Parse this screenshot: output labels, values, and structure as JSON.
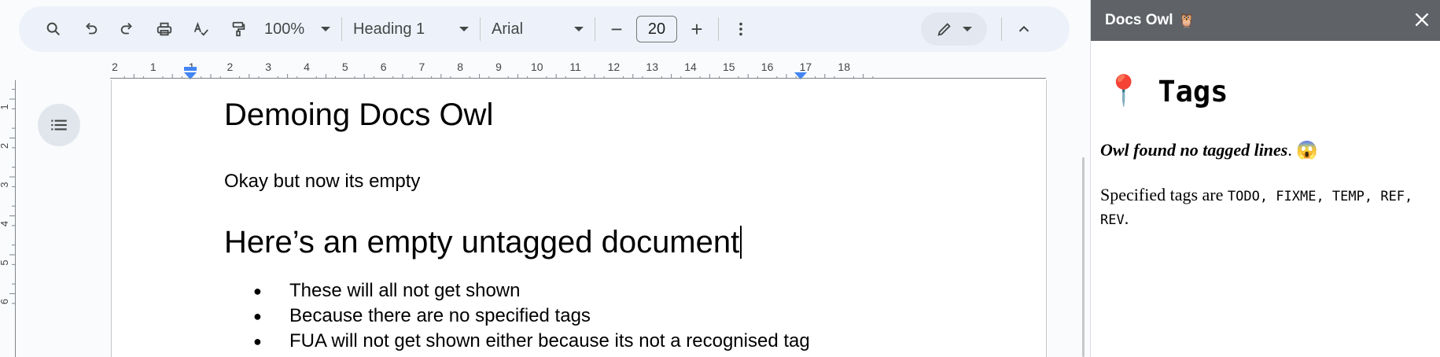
{
  "toolbar": {
    "zoom": "100%",
    "style": "Heading 1",
    "font": "Arial",
    "font_size": "20",
    "minus": "−",
    "plus": "+"
  },
  "ruler": {
    "horizontal_labels": [
      "2",
      "1",
      "1",
      "2",
      "3",
      "4",
      "5",
      "6",
      "7",
      "8",
      "9",
      "10",
      "11",
      "12",
      "13",
      "14",
      "15",
      "16",
      "17",
      "18"
    ],
    "vertical_labels": [
      "1",
      "2",
      "3",
      "4",
      "5",
      "6"
    ]
  },
  "document": {
    "title": "Demoing Docs Owl",
    "paragraph": "Okay but now its empty",
    "heading": "Here’s an empty untagged document",
    "bullets": [
      "These will all not get shown",
      "Because there are no specified tags",
      "FUA will not get shown either because its not a recognised tag"
    ]
  },
  "panel": {
    "title": "Docs Owl",
    "owl_emoji": "🦉",
    "heading_emoji": "📍",
    "heading": "Tags",
    "notice": "Owl found no tagged lines",
    "notice_suffix": ".",
    "notice_emoji": "😱",
    "spec_prefix": "Specified tags are",
    "tags": "TODO, FIXME, TEMP, REF, REV",
    "spec_suffix": "."
  },
  "colors": {
    "toolbar_bg": "#edf2fa",
    "panel_header_bg": "#5f6368",
    "indent_marker": "#4285f4"
  }
}
